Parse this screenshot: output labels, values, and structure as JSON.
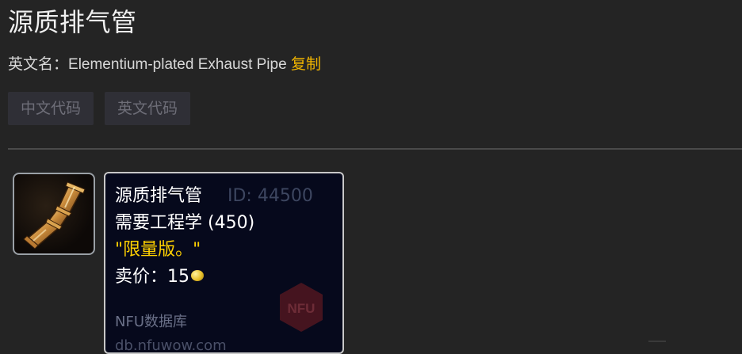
{
  "page": {
    "title": "源质排气管"
  },
  "english_name": {
    "label": "英文名：",
    "value": "Elementium-plated Exhaust Pipe",
    "copy_label": "复制"
  },
  "code_buttons": {
    "chinese_code": "中文代码",
    "english_code": "英文代码"
  },
  "item": {
    "icon": "exhaust-pipe-icon"
  },
  "tooltip": {
    "name": "源质排气管",
    "id_text": "ID: 44500",
    "requirement": "需要工程学 (450)",
    "flavor": "\"限量版。\"",
    "price_label": "卖价：",
    "price_value": "15",
    "coin_icon": "gold-coin-icon",
    "site_label": "NFU数据库",
    "site_url": "db.nfuwow.com",
    "watermark_text": "NFU"
  },
  "colors": {
    "background": "#242424",
    "accent_copy": "#f0b400",
    "tooltip_bg": "#06091c",
    "flavor_text": "#ffd100",
    "watermark_red": "#7a1e22"
  }
}
